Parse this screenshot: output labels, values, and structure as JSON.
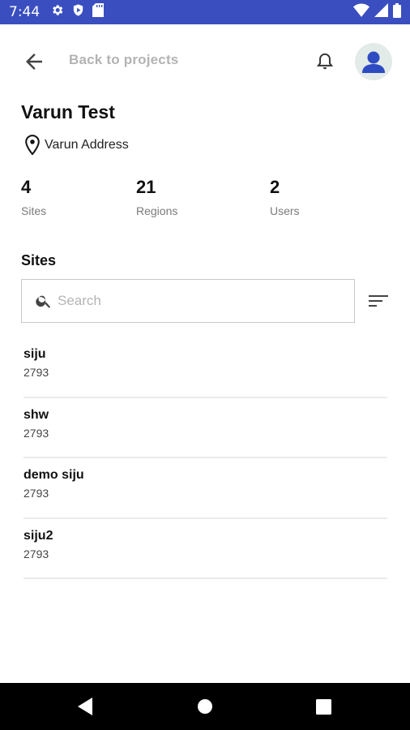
{
  "status_bar": {
    "time": "7:44",
    "icons": [
      "gear-icon",
      "play-protect-icon",
      "sd-card-icon",
      "wifi-icon",
      "signal-icon",
      "battery-icon"
    ],
    "background": "#3a4ec0"
  },
  "header": {
    "back_label": "Back to projects",
    "icons": [
      "arrow-back-icon",
      "bell-icon",
      "account-icon"
    ]
  },
  "project": {
    "title": "Varun Test",
    "address": "Varun Address"
  },
  "stats": [
    {
      "value": "4",
      "label": "Sites"
    },
    {
      "value": "21",
      "label": "Regions"
    },
    {
      "value": "2",
      "label": "Users"
    }
  ],
  "sites_section": {
    "title": "Sites",
    "search_placeholder": "Search",
    "items": [
      {
        "name": "siju",
        "code": "2793"
      },
      {
        "name": "shw",
        "code": "2793"
      },
      {
        "name": "demo siju",
        "code": "2793"
      },
      {
        "name": "siju2",
        "code": "2793"
      }
    ]
  },
  "nav_bar": {
    "buttons": [
      "back-triangle-icon",
      "home-circle-icon",
      "recents-square-icon"
    ]
  },
  "colors": {
    "accent": "#2f4bc2",
    "avatar_bg": "#e2ebe8"
  }
}
